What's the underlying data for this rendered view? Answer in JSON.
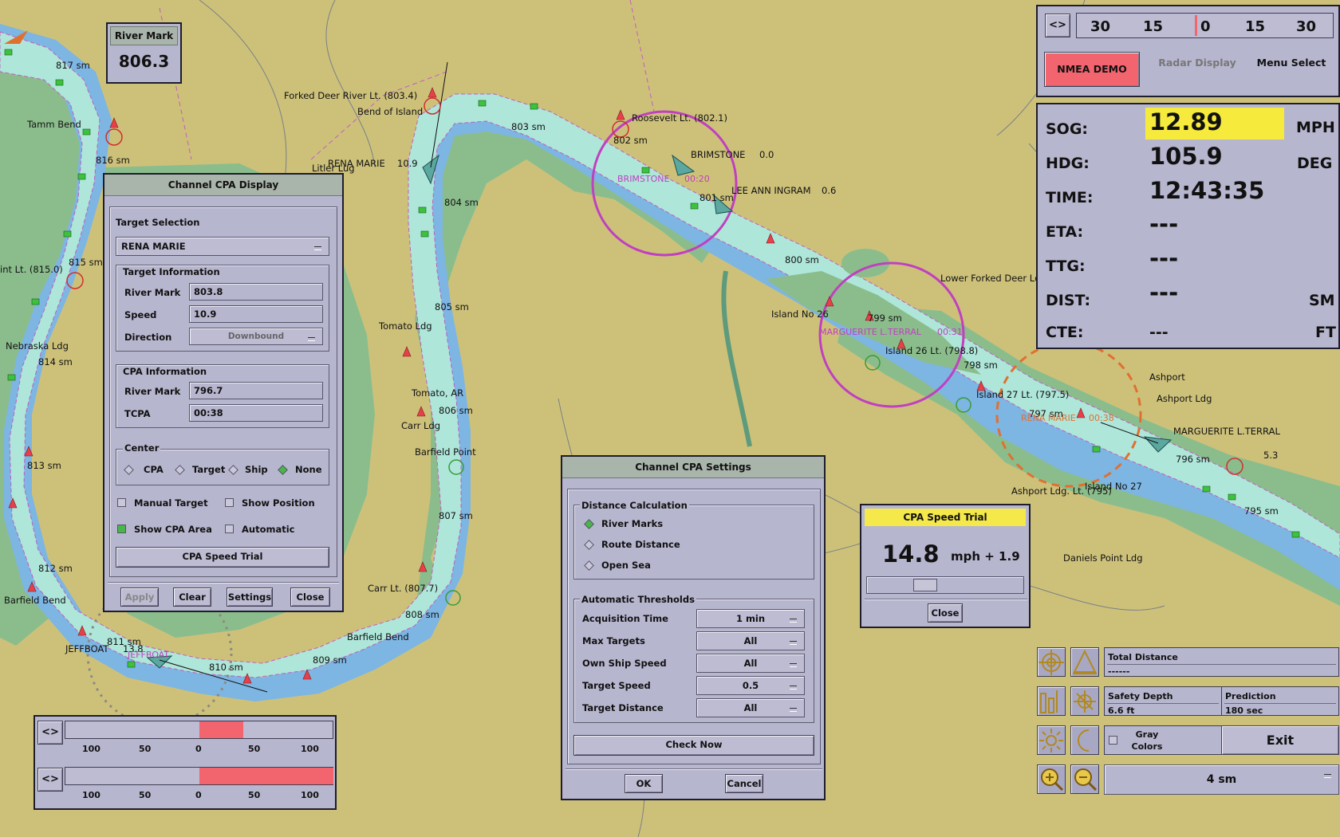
{
  "map": {
    "labels": [
      "817 sm",
      "816 sm",
      "815 sm",
      "814 sm",
      "813 sm",
      "812 sm",
      "811 sm",
      "810 sm",
      "809 sm",
      "808 sm",
      "807 sm",
      "806 sm",
      "805 sm",
      "804 sm",
      "803 sm",
      "802 sm",
      "801 sm",
      "800 sm",
      "799 sm",
      "798 sm",
      "797 sm",
      "796 sm",
      "795 sm",
      "Tamm Bend",
      "Forked Deer River Lt. (803.4)",
      "Bend of Island",
      "Roosevelt Lt. (802.1)",
      "BRIMSTONE",
      "0.0",
      "LEE ANN INGRAM",
      "0.6",
      "RENA MARIE",
      "10.9",
      "Litler Lug",
      "int Lt. (815.0)",
      "Nebraska Ldg",
      "Tomato Ldg",
      "Tomato, AR",
      "Carr Ldg",
      "Barfield Point",
      "Carr Lt. (807.7)",
      "Barfield Bend",
      "Barfield Bend",
      "JEFFBOAT",
      "13.8",
      "Island No 26",
      "Island 26 Lt. (798.8)",
      "Lower Forked Deer Ldg",
      "Island 27 Lt. (797.5)",
      "Ashport",
      "Ashport Ldg",
      "MARGUERITE L.TERRAL",
      "5.3",
      "Ashport Ldg. Lt. (795)",
      "Island No 27",
      "Daniels Point Ldg",
      "Daniels Point"
    ],
    "magenta_labels": [
      "BRIMSTONE",
      "00:20",
      "MARGUERITE L.TERRAL",
      "00:31",
      "JEFFBOAT"
    ],
    "orange_labels": [
      "RENA MARIE",
      "00:38"
    ]
  },
  "river_mark": {
    "title": "River Mark",
    "value": "806.3"
  },
  "cpa_display": {
    "title": "Channel CPA Display",
    "target_selection_label": "Target Selection",
    "target_selected": "RENA MARIE",
    "target_info_label": "Target Information",
    "river_mark_label": "River Mark",
    "river_mark_value": "803.8",
    "speed_label": "Speed",
    "speed_value": "10.9",
    "direction_label": "Direction",
    "direction_value": "Downbound",
    "cpa_info_label": "CPA Information",
    "cpa_river_mark_label": "River Mark",
    "cpa_river_mark_value": "796.7",
    "tcpa_label": "TCPA",
    "tcpa_value": "00:38",
    "center_label": "Center",
    "center_options": [
      "CPA",
      "Target",
      "Ship",
      "None"
    ],
    "center_selected": "None",
    "manual_target": "Manual Target",
    "show_position": "Show Position",
    "show_cpa_area": "Show CPA Area",
    "automatic": "Automatic",
    "speed_trial_button": "CPA Speed Trial",
    "buttons": [
      "Apply",
      "Clear",
      "Settings",
      "Close"
    ]
  },
  "cpa_settings": {
    "title": "Channel CPA Settings",
    "distance_calc_label": "Distance Calculation",
    "distance_options": [
      "River Marks",
      "Route Distance",
      "Open Sea"
    ],
    "distance_selected": "River Marks",
    "thresholds_label": "Automatic Thresholds",
    "thresholds": [
      {
        "label": "Acquisition Time",
        "value": "1 min"
      },
      {
        "label": "Max Targets",
        "value": "All"
      },
      {
        "label": "Own Ship Speed",
        "value": "All"
      },
      {
        "label": "Target Speed",
        "value": "0.5"
      },
      {
        "label": "Target Distance",
        "value": "All"
      }
    ],
    "check_now": "Check Now",
    "ok": "OK",
    "cancel": "Cancel"
  },
  "speed_trial": {
    "title": "CPA Speed Trial",
    "speed": "14.8",
    "unit_delta": "mph + 1.9",
    "slider_level": 0.35,
    "close": "Close",
    "title_color": "#f4e84a"
  },
  "top_bar": {
    "toggle": "<>",
    "scale_ticks": [
      "30",
      "15",
      "0",
      "15",
      "30"
    ],
    "nmea_button": "NMEA DEMO",
    "radar_button": "Radar Display",
    "menu_button": "Menu Select",
    "nmea_color": "#f2646e"
  },
  "instruments": {
    "sog": {
      "label": "SOG:",
      "value": "12.89",
      "unit": "MPH"
    },
    "hdg": {
      "label": "HDG:",
      "value": "105.9",
      "unit": "DEG"
    },
    "time": {
      "label": "TIME:",
      "value": "12:43:35"
    },
    "eta": {
      "label": "ETA:",
      "value": "---"
    },
    "ttg": {
      "label": "TTG:",
      "value": "---"
    },
    "dist": {
      "label": "DIST:",
      "value": "---",
      "unit": "SM"
    },
    "cte": {
      "label": "CTE:",
      "value": "---",
      "unit": "FT"
    },
    "highlight_color": "#f6ea3c"
  },
  "bottom_tools": {
    "total_distance_label": "Total Distance",
    "total_distance_value": "------",
    "safety_depth_label": "Safety Depth",
    "safety_depth_value": "6.6 ft",
    "prediction_label": "Prediction",
    "prediction_value": "180 sec",
    "gray_colors": "Gray Colors",
    "exit": "Exit",
    "range": "4 sm"
  },
  "bottom_bars": {
    "toggle": "<>",
    "ticks": [
      "100",
      "50",
      "0",
      "50",
      "100"
    ],
    "bar1_level": 0.33,
    "bar2_level": 1.0,
    "bar_color": "#f2646e"
  }
}
